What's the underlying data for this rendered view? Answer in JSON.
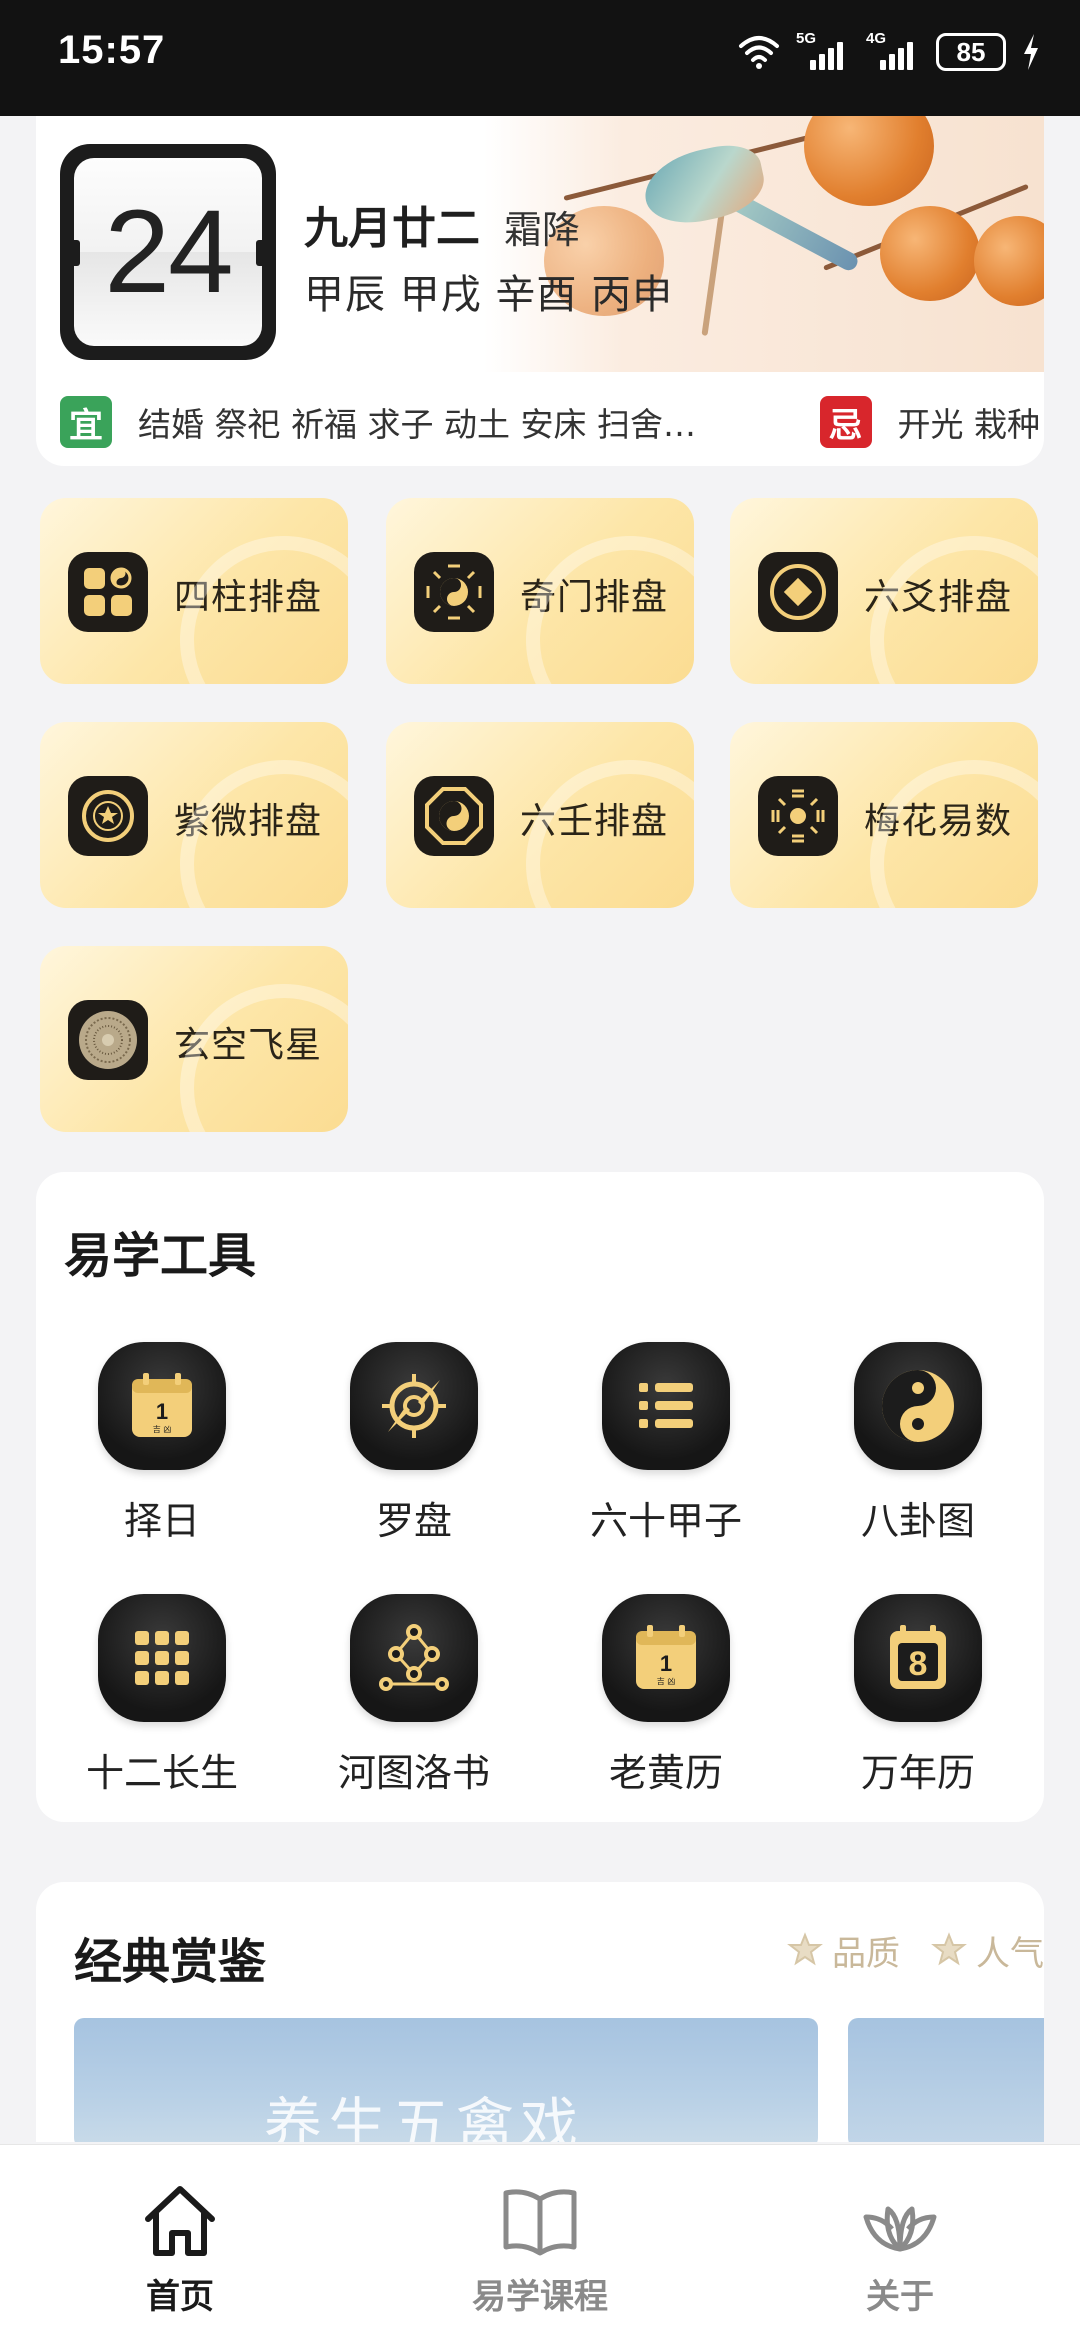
{
  "status_bar": {
    "time": "15:57",
    "signal1_label": "5G",
    "signal2_label": "4G",
    "battery": "85",
    "icons": [
      "wifi-icon",
      "signal-5g-icon",
      "signal-4g-icon",
      "battery-icon",
      "charging-icon"
    ]
  },
  "calendar": {
    "day": "24",
    "lunar_date": "九月廿二",
    "solar_term": "霜降",
    "ganzhi": "甲辰 甲戌 辛酉 丙申",
    "yi_tag": "宜",
    "yi_items": "结婚 祭祀 祈福 求子 动土 安床 扫舍…",
    "ji_tag": "忌",
    "ji_items": "开光 栽种"
  },
  "paipan": [
    {
      "label": "四柱排盘",
      "icon": "four-pillars-icon"
    },
    {
      "label": "奇门排盘",
      "icon": "qimen-bagua-icon"
    },
    {
      "label": "六爻排盘",
      "icon": "coin-icon"
    },
    {
      "label": "紫微排盘",
      "icon": "ziwei-star-icon"
    },
    {
      "label": "六壬排盘",
      "icon": "liuren-taiji-icon"
    },
    {
      "label": "梅花易数",
      "icon": "meihua-bagua-icon"
    },
    {
      "label": "玄空飞星",
      "icon": "compass-plate-icon"
    }
  ],
  "tools": {
    "title": "易学工具",
    "items": [
      {
        "label": "择日",
        "icon": "calendar-day-icon",
        "icon_text": "1",
        "icon_sub": "吉 凶"
      },
      {
        "label": "罗盘",
        "icon": "compass-icon"
      },
      {
        "label": "六十甲子",
        "icon": "list-icon"
      },
      {
        "label": "八卦图",
        "icon": "yin-yang-icon"
      },
      {
        "label": "十二长生",
        "icon": "grid-icon"
      },
      {
        "label": "河图洛书",
        "icon": "network-icon"
      },
      {
        "label": "老黄历",
        "icon": "almanac-icon",
        "icon_text": "1",
        "icon_sub": "吉 凶"
      },
      {
        "label": "万年历",
        "icon": "perpetual-calendar-icon",
        "icon_text": "8"
      }
    ]
  },
  "classics": {
    "title": "经典赏鉴",
    "sort_quality": "品质",
    "sort_popularity": "人气",
    "featured_title": "养生五禽戏"
  },
  "nav": {
    "items": [
      {
        "label": "首页",
        "icon": "home-icon",
        "active": true
      },
      {
        "label": "易学课程",
        "icon": "book-icon",
        "active": false
      },
      {
        "label": "关于",
        "icon": "lotus-icon",
        "active": false
      }
    ]
  },
  "colors": {
    "gold": "#f3cf7a",
    "card_gradient_start": "#fff6dc",
    "card_gradient_end": "#fbdc92",
    "yi_green": "#3aa35a",
    "ji_red": "#d8262c",
    "nav_active": "#1a1a1a",
    "nav_inactive": "#8a8a8a"
  }
}
